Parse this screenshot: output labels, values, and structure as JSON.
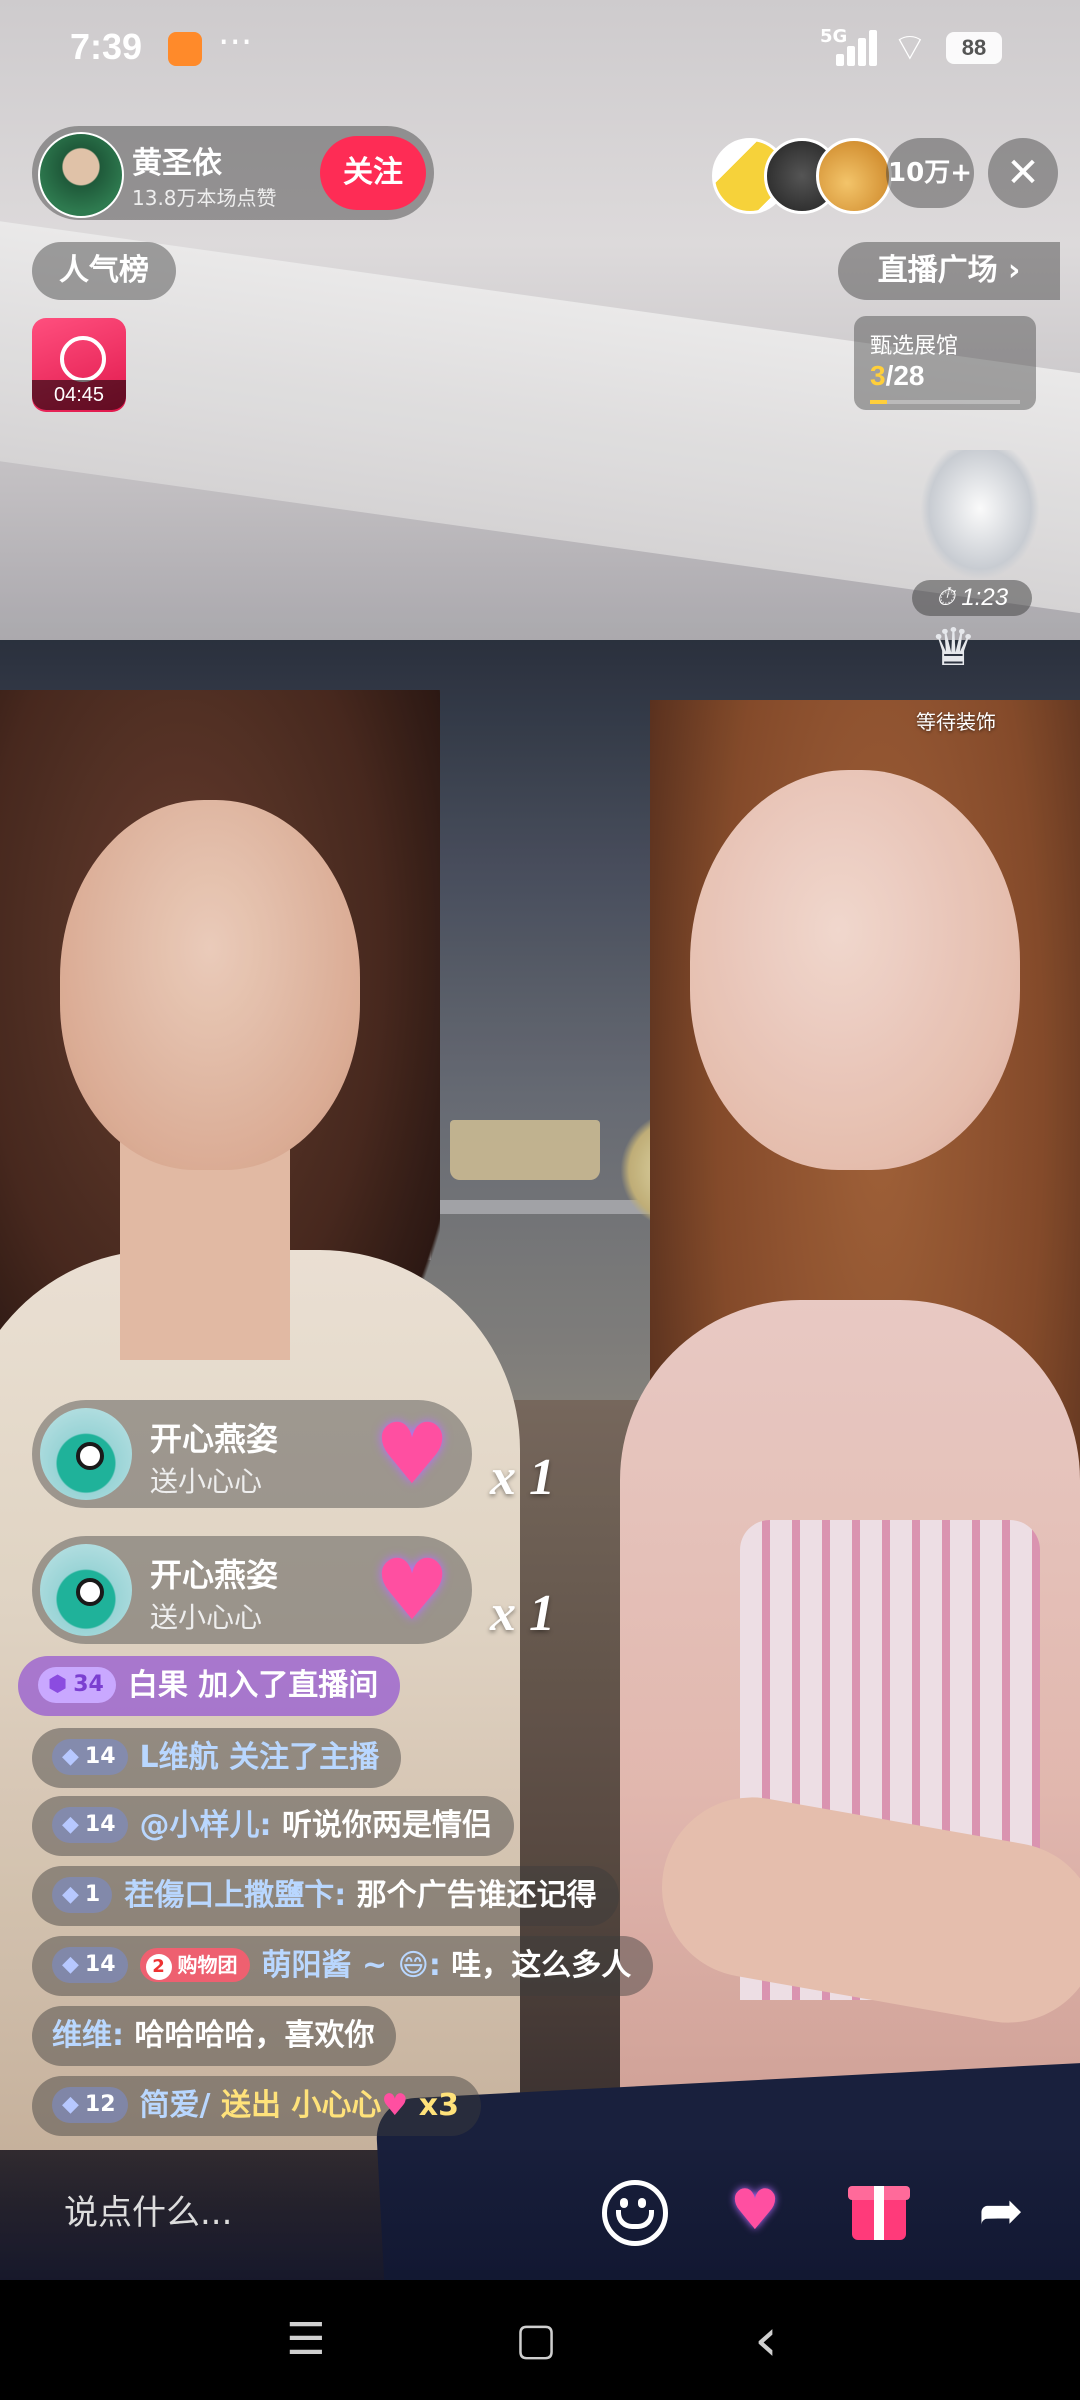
{
  "status_bar": {
    "time": "7:39",
    "dots": "···",
    "network": "5G",
    "battery": "88"
  },
  "host": {
    "name": "黄圣依",
    "likes": "13.8万本场点赞",
    "follow_label": "关注"
  },
  "viewers": {
    "count": "10万+",
    "avatars": [
      "viewer-avatar-1",
      "viewer-avatar-2",
      "viewer-avatar-3"
    ]
  },
  "close_label": "✕",
  "popularity_label": "人气榜",
  "plaza_label": "直播广场 ›",
  "shop": {
    "timer": "04:45"
  },
  "gallery": {
    "title": "甄选展馆",
    "current": "3",
    "total": "/28",
    "progress": 0.11
  },
  "decoration": {
    "timer": "1:23",
    "label": "等待装饰",
    "icon": "crown-icon"
  },
  "gifts": [
    {
      "user": "开心燕姿",
      "action": "送小心心",
      "count": "x 1",
      "icon": "heart-gift-icon"
    },
    {
      "user": "开心燕姿",
      "action": "送小心心",
      "count": "x 1",
      "icon": "heart-gift-icon"
    }
  ],
  "chat": {
    "join": {
      "level": "34",
      "user": "白果",
      "text": " 加入了直播间"
    },
    "follow": {
      "level": "14",
      "user": "L维航",
      "text": " 关注了主播"
    },
    "messages": [
      {
        "level": "14",
        "user": "@小样儿:",
        "text": " 听说你两是情侣"
      },
      {
        "level": "1",
        "user": "茬傷口上撒鹽卞:",
        "text": " 那个广告谁还记得"
      },
      {
        "level": "14",
        "group_num": "2",
        "group_label": "购物团",
        "user": "萌阳酱 ~ 😄:",
        "text": " 哇，这么多人"
      },
      {
        "user": "维维:",
        "text": " 哈哈哈哈，喜欢你"
      }
    ],
    "gift_msg": {
      "level": "12",
      "user": "简爱/",
      "text": " 送出 ",
      "gift": "小心心",
      "count": " x3"
    }
  },
  "bottom": {
    "placeholder": "说点什么...",
    "icons": [
      "emoji-icon",
      "heart-gift-icon",
      "gift-box-icon",
      "share-icon"
    ]
  },
  "nav": {
    "menu_glyph": "☰",
    "home_glyph": "▢",
    "back_glyph": "‹"
  }
}
